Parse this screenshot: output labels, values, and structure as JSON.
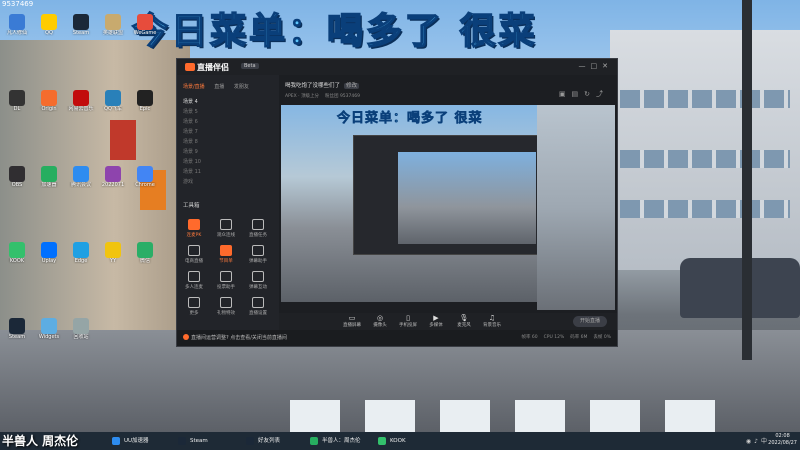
{
  "overlay": {
    "title": "今日菜单：喝多了 很菜",
    "top_left_tag": "9537469",
    "streamer_name": "半兽人 周杰伦"
  },
  "desktop_icons": [
    {
      "label": "凡人修仙",
      "color": "#3a7bd5"
    },
    {
      "label": "QQ",
      "color": "#ffcc00"
    },
    {
      "label": "Steam",
      "color": "#1b2838"
    },
    {
      "label": "英雄联盟",
      "color": "#c8aa6e"
    },
    {
      "label": "WeGame",
      "color": "#e74c3c"
    },
    {
      "label": "DL",
      "color": "#333"
    },
    {
      "label": "Origin",
      "color": "#f56c2d"
    },
    {
      "label": "网易云音乐",
      "color": "#c20c0c"
    },
    {
      "label": "QQ飞车",
      "color": "#2980b9"
    },
    {
      "label": "Epic",
      "color": "#222"
    },
    {
      "label": "OBS",
      "color": "#302e31"
    },
    {
      "label": "加速器",
      "color": "#27ae60"
    },
    {
      "label": "腾讯会议",
      "color": "#2d8cf0"
    },
    {
      "label": "2022071",
      "color": "#8e44ad"
    },
    {
      "label": "Chrome",
      "color": "#4285f4"
    },
    {
      "label": "KOOK",
      "color": "#33c06c"
    },
    {
      "label": "Uplay",
      "color": "#0070ff"
    },
    {
      "label": "Edge",
      "color": "#1fa0e3"
    },
    {
      "label": "YY",
      "color": "#f1c40f"
    },
    {
      "label": "微信",
      "color": "#2aae67"
    },
    {
      "label": "Steam",
      "color": "#1b2838"
    },
    {
      "label": "Widgets",
      "color": "#5dade2"
    },
    {
      "label": "回收站",
      "color": "#95a5a6"
    }
  ],
  "app": {
    "name": "直播伴侣",
    "version_badge": "Beta",
    "header_icons": [
      "minimize-icon",
      "maximize-icon",
      "close-icon"
    ],
    "side_tabs": [
      "场景/直播",
      "直播",
      "发朋友"
    ],
    "scenes": [
      "场景 4",
      "场景 5",
      "场景 6",
      "场景 7",
      "场景 8",
      "场景 9",
      "场景 10",
      "场景 11",
      "游戏"
    ],
    "tools_title": "工具箱",
    "tools": [
      {
        "label": "连麦PK",
        "hot": true
      },
      {
        "label": "观众连线",
        "hot": false
      },
      {
        "label": "直播任务",
        "hot": false
      },
      {
        "label": "电商直播",
        "hot": false
      },
      {
        "label": "节目单",
        "hot": true
      },
      {
        "label": "弹幕助手",
        "hot": false
      },
      {
        "label": "多人连麦",
        "hot": false
      },
      {
        "label": "投票助手",
        "hot": false
      },
      {
        "label": "弹幕互动",
        "hot": false
      },
      {
        "label": "更多",
        "hot": false
      },
      {
        "label": "礼物特效",
        "hot": false
      },
      {
        "label": "直播设置",
        "hot": false
      }
    ],
    "room": {
      "title": "喝我吃饱了没哪些们了",
      "tag": "修改",
      "sub": [
        "APEX · 顶级上分",
        "粉丝团 9537469"
      ]
    },
    "controls": [
      "直播屏幕",
      "摄像头",
      "手机投屏",
      "多媒体",
      "麦克风",
      "背景音乐"
    ],
    "start_label": "开始直播",
    "notice": "直播间运营调整? 点击查看/关闭当前直播间",
    "stats": [
      "帧率 60",
      "CPU 12%",
      "码率 6M",
      "丢帧 0%"
    ]
  },
  "taskbar": {
    "items": [
      {
        "label": "UU加速器",
        "color": "#2d8cf0"
      },
      {
        "label": "Steam",
        "color": "#1b2838"
      },
      {
        "label": "好友列表",
        "color": "#1b2838"
      },
      {
        "label": "半兽人：周杰伦",
        "color": "#27ae60"
      },
      {
        "label": "KOOK",
        "color": "#33c06c"
      }
    ],
    "time": "02:08",
    "date": "2022/08/27"
  }
}
